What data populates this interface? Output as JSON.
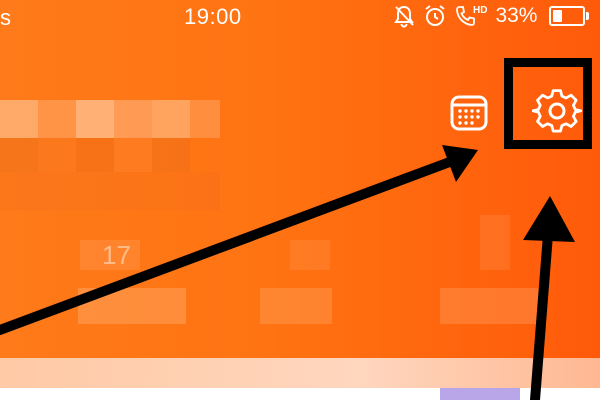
{
  "status_bar": {
    "left_text": "s",
    "time": "19:00",
    "icons": [
      "silent-bell-icon",
      "alarm-clock-icon",
      "hd-call-icon"
    ],
    "hd_label": "HD",
    "battery_percent": "33%",
    "battery_level": 0.33
  },
  "header": {
    "calendar_icon": "calendar-icon",
    "settings_icon": "gear-icon"
  },
  "obscured": {
    "day_number": "17"
  },
  "colors": {
    "background_start": "#ff7a1a",
    "background_end": "#ff5a0a",
    "foreground": "#ffffff",
    "annotation": "#000000"
  }
}
